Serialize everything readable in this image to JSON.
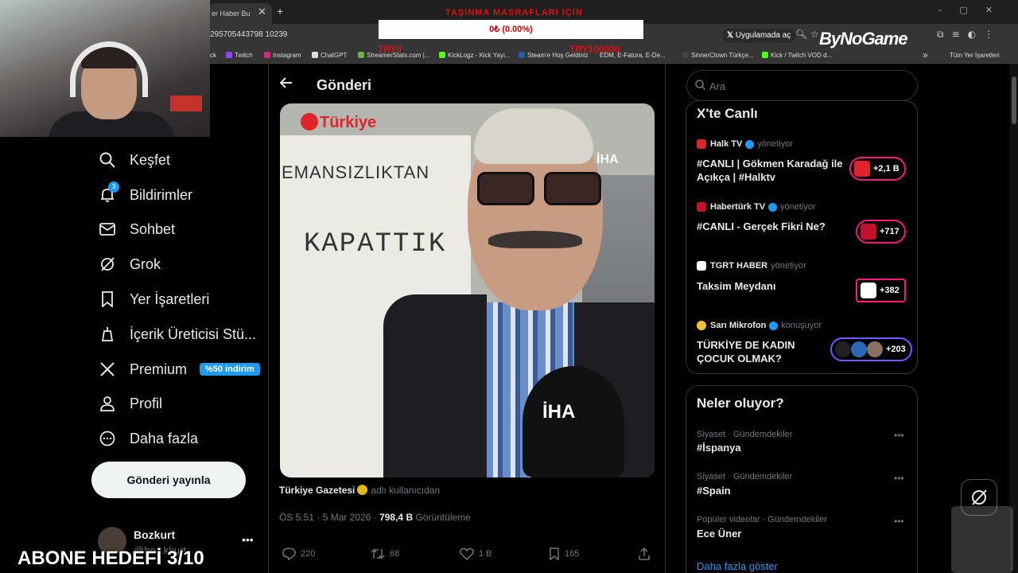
{
  "browser": {
    "tab_title": "er Haber Bu",
    "url": "295705443798 10239",
    "app_mode_label": "Uygulamada aç",
    "bookmarks": [
      "Twitch",
      "Instagram",
      "ChatGPT",
      "StreamerStats.com |...",
      "KickLogz - Kick Yayı...",
      "Steam'e Hoş Geldiniz",
      "EDM, E-Fatura, E-De...",
      "SinnerClown Türkçe...",
      "Kick / Twitch VOD d..."
    ],
    "bookmarks_all": "Tüm Yer İşaretleri",
    "bookmarks_k": "ck"
  },
  "overlay": {
    "title": "TAŞINMA MASRAFLARI İÇİN",
    "progress": "0₺ (0.00%)",
    "progress_value": 0,
    "min_label": "TRY0",
    "max_label": "TRY100000",
    "brand": "ByNoGame",
    "subscriber_goal": "ABONE HEDEFİ 3/10"
  },
  "sidebar": {
    "items": [
      {
        "label": "Keşfet",
        "icon": "search-icon"
      },
      {
        "label": "Bildirimler",
        "icon": "bell-icon",
        "badge": "3"
      },
      {
        "label": "Sohbet",
        "icon": "mail-icon"
      },
      {
        "label": "Grok",
        "icon": "grok-icon"
      },
      {
        "label": "Yer İşaretleri",
        "icon": "bookmark-icon"
      },
      {
        "label": "İçerik Üreticisi Stü...",
        "icon": "creator-icon"
      },
      {
        "label": "Premium",
        "icon": "x-icon",
        "promo": "%50 indirim"
      },
      {
        "label": "Profil",
        "icon": "person-icon"
      },
      {
        "label": "Daha fazla",
        "icon": "more-circle-icon"
      }
    ],
    "post_button": "Gönderi yayınla",
    "profile": {
      "name": "Bozkurt",
      "handle": "@boz.kkurt"
    }
  },
  "main": {
    "page_title": "Gönderi",
    "media": {
      "logo_left": "Türkiye",
      "logo_right": "İHA",
      "sign_line1": "EMANSIZLIKTAN",
      "sign_line2": "KAPATTIK",
      "mic_label": "İHA"
    },
    "author": "Türkiye Gazetesi",
    "author_sub": "adlı kullanıcıdan",
    "time": "ÖS 5:51 · 5 Mar 2026 ·",
    "views": "798,4 B",
    "views_label": "Görüntüleme",
    "actions": {
      "replies": "220",
      "reposts": "68",
      "likes": "1 B",
      "bookmarks": "165"
    }
  },
  "right": {
    "search_placeholder": "Ara",
    "live": {
      "title": "X'te Canlı",
      "items": [
        {
          "source": "Halk TV",
          "role": "yönetiyor",
          "title": "#CANLI | Gökmen Karadağ ile Açıkça | #Halktv",
          "count": "+2,1 B",
          "color": "#e0242b"
        },
        {
          "source": "Habertürk TV",
          "role": "yönetiyor",
          "title": "#CANLI - Gerçek Fikri Ne?",
          "count": "+717",
          "color": "#c4122e"
        },
        {
          "source": "TGRT HABER",
          "role": "yönetiyor",
          "title": "Taksim Meydanı",
          "count": "+382",
          "color": "#ffffff"
        },
        {
          "source": "Sarı Mikrofon",
          "role": "konuşuyor",
          "title": "TÜRKİYE DE KADIN ÇOCUK OLMAK?",
          "count": "+203",
          "color": "#7856ff"
        }
      ]
    },
    "trends": {
      "title": "Neler oluyor?",
      "items": [
        {
          "category": "Siyaset · Gündemdekiler",
          "name": "#İspanya"
        },
        {
          "category": "Siyaset · Gündemdekiler",
          "name": "#Spain"
        },
        {
          "category": "Popüler videolar · Gündemdekiler",
          "name": "Ece Üner"
        }
      ],
      "show_more": "Daha fazla göster"
    }
  }
}
